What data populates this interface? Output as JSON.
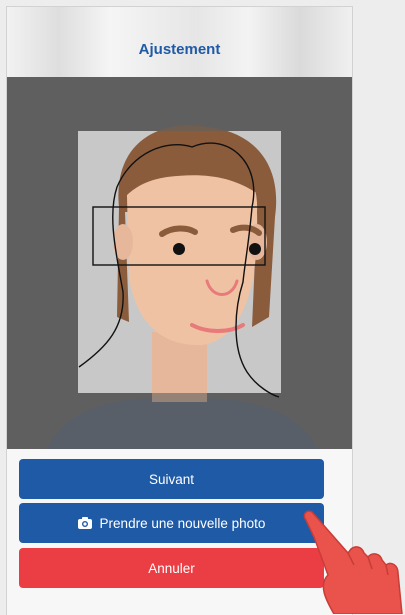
{
  "header": {
    "title": "Ajustement"
  },
  "buttons": {
    "next_label": "Suivant",
    "new_photo_label": "Prendre une nouvelle photo",
    "cancel_label": "Annuler"
  },
  "icons": {
    "camera": "camera-icon",
    "hand": "pointing-hand-icon"
  },
  "colors": {
    "primary": "#1f5aa6",
    "danger": "#ea3d44",
    "title": "#1f5aa6"
  }
}
